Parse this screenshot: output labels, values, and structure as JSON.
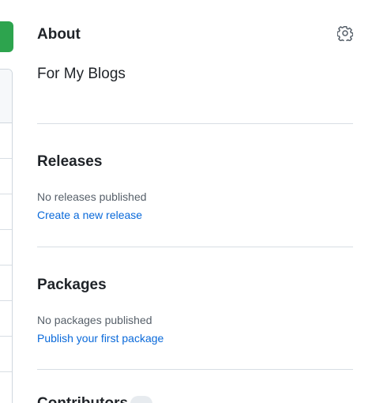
{
  "about": {
    "title": "About",
    "settings_icon": "gear-icon",
    "description": "For My Blogs"
  },
  "releases": {
    "title": "Releases",
    "empty_text": "No releases published",
    "link_text": "Create a new release"
  },
  "packages": {
    "title": "Packages",
    "empty_text": "No packages published",
    "link_text": "Publish your first package"
  },
  "contributors": {
    "title": "Contributors"
  },
  "colors": {
    "text": "#1f2328",
    "muted": "#57606a",
    "link": "#0969da",
    "divider": "#d8dee4",
    "code_button": "#2da44e"
  }
}
